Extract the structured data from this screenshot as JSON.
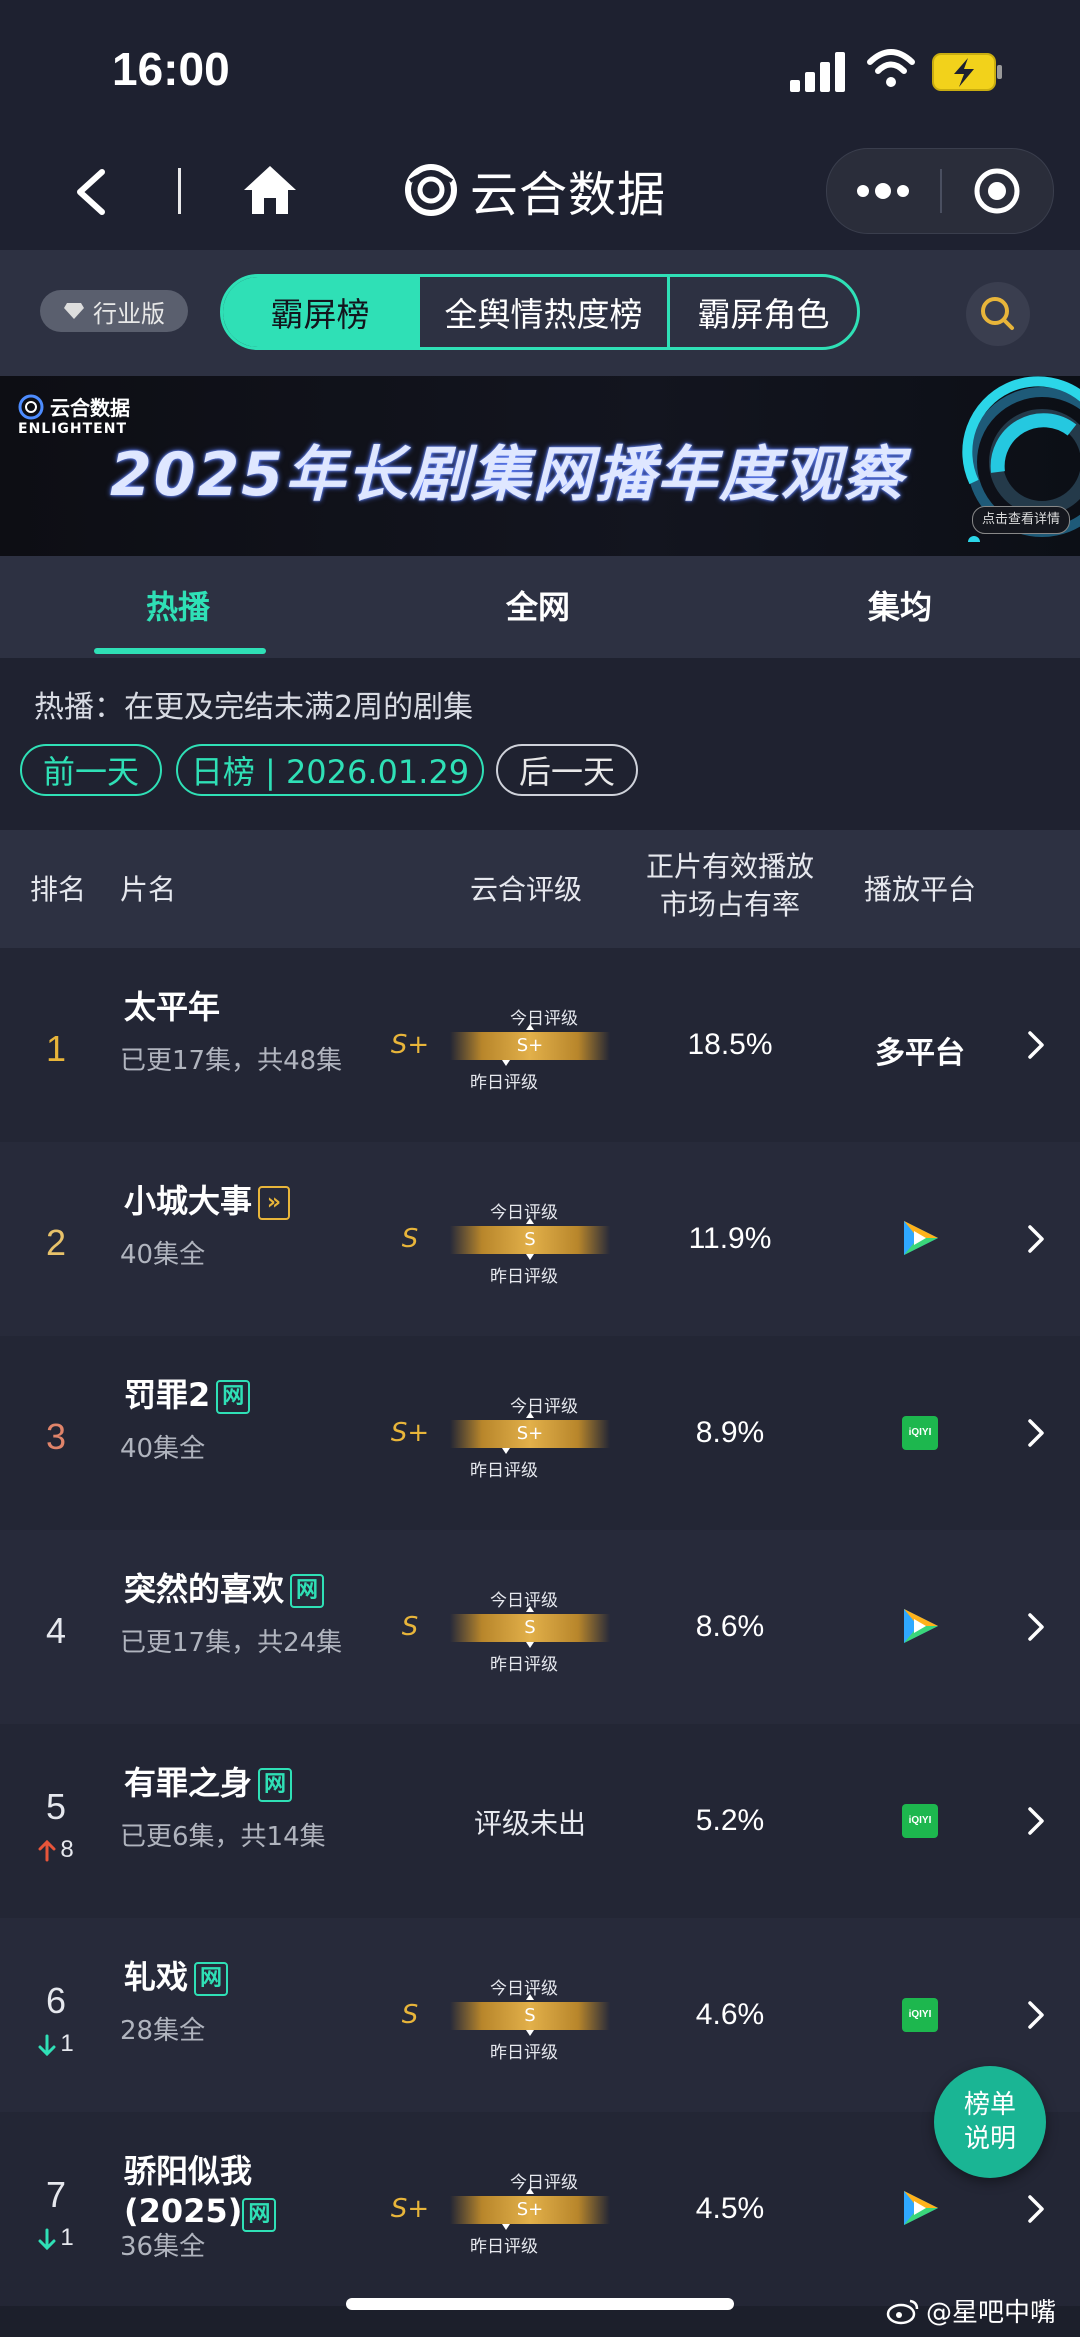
{
  "status_bar": {
    "time": "16:00"
  },
  "nav": {
    "brand": "云合数据"
  },
  "toolbar": {
    "edition_label": "行业版",
    "segments": [
      "霸屏榜",
      "全舆情热度榜",
      "霸屏角色"
    ]
  },
  "banner": {
    "logo_cn": "云合数据",
    "logo_en": "ENLIGHTENT",
    "title": "2025年长剧集网播年度观察",
    "cta": "点击查看详情"
  },
  "sub_tabs": [
    "热播",
    "全网",
    "集均"
  ],
  "info": {
    "description": "热播：在更及完结未满2周的剧集",
    "prev_day": "前一天",
    "date_label": "日榜 | 2026.01.29",
    "next_day": "后一天"
  },
  "table_header": {
    "rank": "排名",
    "title": "片名",
    "grade": "云合评级",
    "share_line1": "正片有效播放",
    "share_line2": "市场占有率",
    "platform": "播放平台"
  },
  "grade_labels": {
    "today": "今日评级",
    "yesterday": "昨日评级"
  },
  "rows": [
    {
      "rank": "1",
      "title": "太平年",
      "tag": "",
      "sub": "已更17集，共48集",
      "grade": "S+",
      "bar_grade": "S+",
      "share": "18.5%",
      "platform_text": "多平台",
      "platform_icon": "",
      "rank_color": "#e8b53a"
    },
    {
      "rank": "2",
      "title": "小城大事",
      "tag": "»",
      "sub": "40集全",
      "grade": "S",
      "bar_grade": "S",
      "share": "11.9%",
      "platform_text": "",
      "platform_icon": "tencent-video-icon",
      "rank_color": "#e8c26a"
    },
    {
      "rank": "3",
      "title": "罚罪2",
      "tag": "网",
      "sub": "40集全",
      "grade": "S+",
      "bar_grade": "S+",
      "share": "8.9%",
      "platform_text": "",
      "platform_icon": "iqiyi-icon",
      "rank_color": "#e0846a"
    },
    {
      "rank": "4",
      "title": "突然的喜欢",
      "tag": "网",
      "sub": "已更17集，共24集",
      "grade": "S",
      "bar_grade": "S",
      "share": "8.6%",
      "platform_text": "",
      "platform_icon": "tencent-video-icon",
      "rank_color": "#e6e8ee"
    },
    {
      "rank": "5",
      "change": "8",
      "change_dir": "up",
      "title": "有罪之身",
      "tag": "网",
      "sub": "已更6集，共14集",
      "grade": "",
      "no_grade": "评级未出",
      "share": "5.2%",
      "platform_text": "",
      "platform_icon": "iqiyi-icon",
      "rank_color": "#e6e8ee"
    },
    {
      "rank": "6",
      "change": "1",
      "change_dir": "down",
      "title": "轧戏",
      "tag": "网",
      "sub": "28集全",
      "grade": "S",
      "bar_grade": "S",
      "share": "4.6%",
      "platform_text": "",
      "platform_icon": "iqiyi-icon",
      "rank_color": "#e6e8ee"
    },
    {
      "rank": "7",
      "change": "1",
      "change_dir": "down",
      "title": "骄阳似我(2025)",
      "tag": "网",
      "sub": "36集全",
      "grade": "S+",
      "bar_grade": "S+",
      "share": "4.5%",
      "platform_text": "",
      "platform_icon": "tencent-video-icon",
      "rank_color": "#e6e8ee"
    }
  ],
  "iqiyi_text": "iQIYI",
  "fab": {
    "line1": "榜单",
    "line2": "说明"
  },
  "weibo_handle": "@星吧中嘴",
  "colors": {
    "accent": "#2fe0b6",
    "gold": "#e8b53a",
    "up": "#e8553a",
    "down": "#2fe0b6",
    "background": "#1c1f2b"
  }
}
